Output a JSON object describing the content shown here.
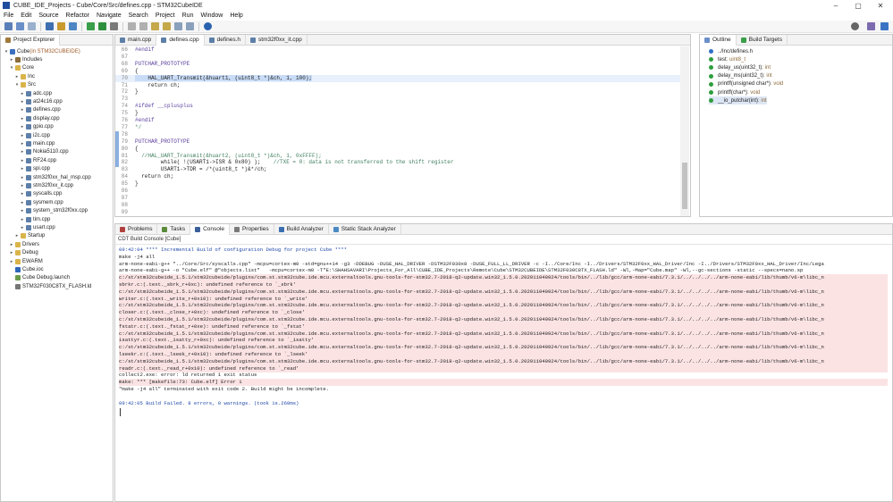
{
  "window": {
    "title": "CUBE_IDE_Projects - Cube/Core/Src/defines.cpp - STM32CubeIDE"
  },
  "menu": [
    "File",
    "Edit",
    "Source",
    "Refactor",
    "Navigate",
    "Search",
    "Project",
    "Run",
    "Window",
    "Help"
  ],
  "project_explorer": {
    "tab_label": "Project Explorer",
    "rows": [
      {
        "label": "Cube",
        "suffix": " (in STM32CUBEIDE)",
        "depth": 0,
        "toggle": "▾",
        "icon": "project"
      },
      {
        "label": "Includes",
        "depth": 1,
        "toggle": "▸",
        "icon": "includes"
      },
      {
        "label": "Core",
        "depth": 1,
        "toggle": "▾",
        "icon": "folder"
      },
      {
        "label": "Inc",
        "depth": 2,
        "toggle": "▸",
        "icon": "folder"
      },
      {
        "label": "Src",
        "depth": 2,
        "toggle": "▾",
        "icon": "folder"
      },
      {
        "label": "adc.cpp",
        "depth": 3,
        "toggle": "▸",
        "icon": "cpp"
      },
      {
        "label": "at24c16.cpp",
        "depth": 3,
        "toggle": "▸",
        "icon": "cpp"
      },
      {
        "label": "defines.cpp",
        "depth": 3,
        "toggle": "▸",
        "icon": "cpp"
      },
      {
        "label": "display.cpp",
        "depth": 3,
        "toggle": "▸",
        "icon": "cpp"
      },
      {
        "label": "gpio.cpp",
        "depth": 3,
        "toggle": "▸",
        "icon": "cpp"
      },
      {
        "label": "i2c.cpp",
        "depth": 3,
        "toggle": "▸",
        "icon": "cpp"
      },
      {
        "label": "main.cpp",
        "depth": 3,
        "toggle": "▸",
        "icon": "cpp"
      },
      {
        "label": "Nokia5110.cpp",
        "depth": 3,
        "toggle": "▸",
        "icon": "cpp"
      },
      {
        "label": "RF24.cpp",
        "depth": 3,
        "toggle": "▸",
        "icon": "cpp"
      },
      {
        "label": "spi.cpp",
        "depth": 3,
        "toggle": "▸",
        "icon": "cpp"
      },
      {
        "label": "stm32f0xx_hal_msp.cpp",
        "depth": 3,
        "toggle": "▸",
        "icon": "cpp"
      },
      {
        "label": "stm32f0xx_it.cpp",
        "depth": 3,
        "toggle": "▸",
        "icon": "cpp"
      },
      {
        "label": "syscalls.cpp",
        "depth": 3,
        "toggle": "▸",
        "icon": "cpp"
      },
      {
        "label": "sysmem.cpp",
        "depth": 3,
        "toggle": "▸",
        "icon": "cpp"
      },
      {
        "label": "system_stm32f0xx.cpp",
        "depth": 3,
        "toggle": "▸",
        "icon": "cpp"
      },
      {
        "label": "tim.cpp",
        "depth": 3,
        "toggle": "▸",
        "icon": "cpp"
      },
      {
        "label": "usart.cpp",
        "depth": 3,
        "toggle": "▸",
        "icon": "cpp"
      },
      {
        "label": "Startup",
        "depth": 2,
        "toggle": "▸",
        "icon": "folder"
      },
      {
        "label": "Drivers",
        "depth": 1,
        "toggle": "▸",
        "icon": "folder"
      },
      {
        "label": "Debug",
        "depth": 1,
        "toggle": "▸",
        "icon": "folder"
      },
      {
        "label": "EWARM",
        "depth": 1,
        "toggle": "▸",
        "icon": "folder"
      },
      {
        "label": "Cube.ioc",
        "depth": 1,
        "toggle": "",
        "icon": "ioc"
      },
      {
        "label": "Cube Debug.launch",
        "depth": 1,
        "toggle": "",
        "icon": "launch"
      },
      {
        "label": "STM32F030C8TX_FLASH.ld",
        "depth": 1,
        "toggle": "",
        "icon": "ld"
      }
    ]
  },
  "editor": {
    "tabs": [
      "main.cpp",
      "defines.cpp",
      "defines.h",
      "stm32f0xx_it.cpp"
    ],
    "active_tab": 1,
    "lines": [
      {
        "n": "66",
        "segs": [
          {
            "t": "#endif",
            "c": "mc"
          }
        ]
      },
      {
        "n": "67",
        "segs": []
      },
      {
        "n": "68",
        "segs": [
          {
            "t": "PUTCHAR_PROTOTYPE",
            "c": "mc"
          }
        ]
      },
      {
        "n": "69",
        "segs": [
          {
            "t": "{",
            "c": ""
          }
        ]
      },
      {
        "n": "70",
        "segs": [
          {
            "t": "    HAL_UART_Transmit(&huart1, (uint8_t *)&ch, 1, 100);",
            "c": "sel"
          }
        ]
      },
      {
        "n": "71",
        "segs": [
          {
            "t": "    return ch;",
            "c": ""
          }
        ]
      },
      {
        "n": "72",
        "segs": [
          {
            "t": "}",
            "c": ""
          }
        ]
      },
      {
        "n": "73",
        "segs": []
      },
      {
        "n": "74",
        "segs": [
          {
            "t": "#ifdef __cplusplus",
            "c": "mc"
          }
        ]
      },
      {
        "n": "75",
        "segs": [
          {
            "t": "}",
            "c": ""
          }
        ]
      },
      {
        "n": "76",
        "segs": [
          {
            "t": "#endif",
            "c": "mc"
          }
        ]
      },
      {
        "n": "77",
        "segs": [
          {
            "t": "*/",
            "c": "cm"
          }
        ]
      },
      {
        "n": "78",
        "segs": []
      },
      {
        "n": "79",
        "segs": [
          {
            "t": "PUTCHAR_PROTOTYPE",
            "c": "mc"
          }
        ]
      },
      {
        "n": "80",
        "segs": [
          {
            "t": "{",
            "c": ""
          }
        ]
      },
      {
        "n": "81",
        "segs": [
          {
            "t": "  //HAL_UART_Transmit(&huart2, (uint8_t *)&ch, 1, 0xFFFF);",
            "c": "cm"
          }
        ]
      },
      {
        "n": "82",
        "segs": [
          {
            "t": "        while( !(USART1->ISR & 0x80) );    ",
            "c": ""
          },
          {
            "t": "//TXE = 0: data is not transferred to the shift register",
            "c": "cm"
          }
        ]
      },
      {
        "n": "83",
        "segs": [
          {
            "t": "        USART1->TDR = /*(uint8_t *)&*/ch;",
            "c": ""
          }
        ]
      },
      {
        "n": "84",
        "segs": [
          {
            "t": "  return ch;",
            "c": ""
          }
        ]
      },
      {
        "n": "85",
        "segs": [
          {
            "t": "}",
            "c": ""
          }
        ]
      },
      {
        "n": "86",
        "segs": []
      },
      {
        "n": "87",
        "segs": []
      },
      {
        "n": "88",
        "segs": []
      },
      {
        "n": "89",
        "segs": []
      }
    ]
  },
  "outline": {
    "tabs": [
      "Outline",
      "Build Targets"
    ],
    "items": [
      {
        "label": "../Inc/defines.h",
        "type": "",
        "icon": "include"
      },
      {
        "label": "test",
        "type": " : uint8_t",
        "icon": "var"
      },
      {
        "label": "delay_us(uint32_t)",
        "type": " : int",
        "icon": "fn"
      },
      {
        "label": "delay_ms(uint32_t)",
        "type": " : int",
        "icon": "fn"
      },
      {
        "label": "printff(unsigned char*)",
        "type": " : void",
        "icon": "fn"
      },
      {
        "label": "printff(char*)",
        "type": " : void",
        "icon": "fn"
      },
      {
        "label": "__io_putchar(int)",
        "type": " : int",
        "icon": "fn",
        "selected": true
      }
    ]
  },
  "bottom": {
    "tabs": [
      "Problems",
      "Tasks",
      "Console",
      "Properties",
      "Build Analyzer",
      "Static Stack Analyzer"
    ],
    "active_tab": 2,
    "console_title": "CDT Build Console [Cube]",
    "lines": [
      {
        "t": "09:42:04 **** Incremental Build of configuration Debug for project Cube ****",
        "c": "info"
      },
      {
        "t": "make -j4 all",
        "c": ""
      },
      {
        "t": "arm-none-eabi-g++ \"../Core/Src/syscalls.cpp\" -mcpu=cortex-m0 -std=gnu++14 -g3 -DDEBUG -DUSE_HAL_DRIVER -DSTM32F030x8 -DUSE_FULL_LL_DRIVER -c -I../Core/Inc -I../Drivers/STM32F0xx_HAL_Driver/Inc -I../Drivers/STM32F0xx_HAL_Driver/Inc/Lega",
        "c": ""
      },
      {
        "t": "arm-none-eabi-g++ -o \"Cube.elf\" @\"objects.list\"   -mcpu=cortex-m0 -T\"E:\\SHAHSAVARI\\Projects_For_All\\CUBE_IDE_Projects\\Remote\\Cube\\STM32CUBEIDE\\STM32F030C8TX_FLASH.ld\" -Wl,-Map=\"Cube.map\" -Wl,--gc-sections -static --specs=nano.sp",
        "c": ""
      },
      {
        "t": "c:/st/stm32cubeide_1.5.1/stm32cubeide/plugins/com.st.stm32cube.ide.mcu.externaltools.gnu-tools-for-stm32.7-2018-q2-update.win32_1.5.0.202011040924/tools/bin/../lib/gcc/arm-none-eabi/7.3.1/../../../../arm-none-eabi/lib/thumb/v6-m\\libc_n",
        "c": "err"
      },
      {
        "t": "sbrkr.c:(.text._sbrk_r+0xc): undefined reference to `_sbrk'",
        "c": "err"
      },
      {
        "t": "c:/st/stm32cubeide_1.5.1/stm32cubeide/plugins/com.st.stm32cube.ide.mcu.externaltools.gnu-tools-for-stm32.7-2018-q2-update.win32_1.5.0.202011040924/tools/bin/../lib/gcc/arm-none-eabi/7.3.1/../../../../arm-none-eabi/lib/thumb/v6-m\\libc_n",
        "c": "err"
      },
      {
        "t": "writer.c:(.text._write_r+0x10): undefined reference to `_write'",
        "c": "err"
      },
      {
        "t": "c:/st/stm32cubeide_1.5.1/stm32cubeide/plugins/com.st.stm32cube.ide.mcu.externaltools.gnu-tools-for-stm32.7-2018-q2-update.win32_1.5.0.202011040924/tools/bin/../lib/gcc/arm-none-eabi/7.3.1/../../../../arm-none-eabi/lib/thumb/v6-m\\libc_n",
        "c": "err"
      },
      {
        "t": "closer.c:(.text._close_r+0xc): undefined reference to `_close'",
        "c": "err"
      },
      {
        "t": "c:/st/stm32cubeide_1.5.1/stm32cubeide/plugins/com.st.stm32cube.ide.mcu.externaltools.gnu-tools-for-stm32.7-2018-q2-update.win32_1.5.0.202011040924/tools/bin/../lib/gcc/arm-none-eabi/7.3.1/../../../../arm-none-eabi/lib/thumb/v6-m\\libc_n",
        "c": "err"
      },
      {
        "t": "fstatr.c:(.text._fstat_r+0xe): undefined reference to `_fstat'",
        "c": "err"
      },
      {
        "t": "c:/st/stm32cubeide_1.5.1/stm32cubeide/plugins/com.st.stm32cube.ide.mcu.externaltools.gnu-tools-for-stm32.7-2018-q2-update.win32_1.5.0.202011040924/tools/bin/../lib/gcc/arm-none-eabi/7.3.1/../../../../arm-none-eabi/lib/thumb/v6-m\\libc_n",
        "c": "err"
      },
      {
        "t": "isattyr.c:(.text._isatty_r+0xc): undefined reference to `_isatty'",
        "c": "err"
      },
      {
        "t": "c:/st/stm32cubeide_1.5.1/stm32cubeide/plugins/com.st.stm32cube.ide.mcu.externaltools.gnu-tools-for-stm32.7-2018-q2-update.win32_1.5.0.202011040924/tools/bin/../lib/gcc/arm-none-eabi/7.3.1/../../../../arm-none-eabi/lib/thumb/v6-m\\libc_n",
        "c": "err"
      },
      {
        "t": "lseekr.c:(.text._lseek_r+0x10): undefined reference to `_lseek'",
        "c": "err"
      },
      {
        "t": "c:/st/stm32cubeide_1.5.1/stm32cubeide/plugins/com.st.stm32cube.ide.mcu.externaltools.gnu-tools-for-stm32.7-2018-q2-update.win32_1.5.0.202011040924/tools/bin/../lib/gcc/arm-none-eabi/7.3.1/../../../../arm-none-eabi/lib/thumb/v6-m\\libc_n",
        "c": "err"
      },
      {
        "t": "readr.c:(.text._read_r+0x10): undefined reference to `_read'",
        "c": "err"
      },
      {
        "t": "collect2.exe: error: ld returned 1 exit status",
        "c": ""
      },
      {
        "t": "make: *** [makefile:73: Cube.elf] Error 1",
        "c": "err"
      },
      {
        "t": "\"make -j4 all\" terminated with exit code 2. Build might be incomplete.",
        "c": ""
      },
      {
        "t": "",
        "c": ""
      },
      {
        "t": "09:42:05 Build Failed. 8 errors, 0 warnings. (took 1s.260ms)",
        "c": "info"
      }
    ]
  },
  "colors": {
    "error_bg": "#fbe3e4",
    "info_text": "#1f48a8",
    "selection": "#c9dcf7"
  }
}
